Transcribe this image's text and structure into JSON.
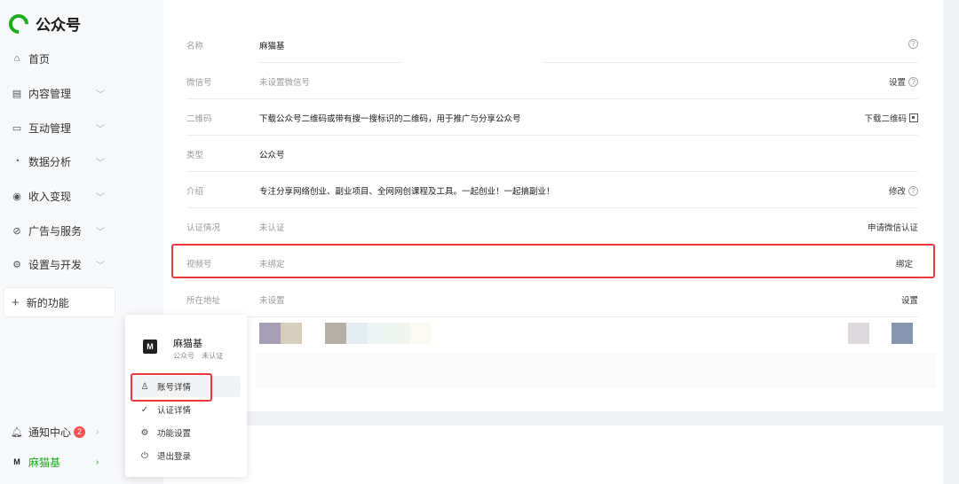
{
  "app": {
    "logo_text": "公众号"
  },
  "sidebar": {
    "items": [
      {
        "label": "首页",
        "icon": "home-icon",
        "glyph": "⌂",
        "chevron": false
      },
      {
        "label": "内容管理",
        "icon": "document-icon",
        "glyph": "▤",
        "chevron": true
      },
      {
        "label": "互动管理",
        "icon": "chat-icon",
        "glyph": "▭",
        "chevron": true
      },
      {
        "label": "数据分析",
        "icon": "chart-icon",
        "glyph": "◔",
        "chevron": true
      },
      {
        "label": "收入变现",
        "icon": "coin-icon",
        "glyph": "◉",
        "chevron": true
      },
      {
        "label": "广告与服务",
        "icon": "compass-icon",
        "glyph": "⊘",
        "chevron": true
      },
      {
        "label": "设置与开发",
        "icon": "gear-icon",
        "glyph": "⚙",
        "chevron": true
      }
    ],
    "new_feature": "新的功能",
    "notification": {
      "label": "通知中心",
      "count": "2"
    },
    "user": {
      "label": "麻猫基"
    }
  },
  "account": {
    "rows": [
      {
        "label": "名称",
        "value": "麻猫基",
        "action": ""
      },
      {
        "label": "微信号",
        "value": "未设置微信号",
        "action": "设置"
      },
      {
        "label": "二维码",
        "value": "下载公众号二维码或带有搜一搜标识的二维码，用于推广与分享公众号",
        "action": "下载二维码"
      },
      {
        "label": "类型",
        "value": "公众号",
        "action": ""
      },
      {
        "label": "介绍",
        "value": "专注分享网络创业、副业项目、全网网创课程及工具。一起创业！一起搞副业！",
        "action": "修改"
      },
      {
        "label": "认证情况",
        "value": "未认证",
        "action": "申请微信认证"
      },
      {
        "label": "视频号",
        "value": "未绑定",
        "action": "绑定"
      },
      {
        "label": "所在地址",
        "value": "未设置",
        "action": "设置"
      }
    ]
  },
  "popup": {
    "avatar_text": "M",
    "name": "麻猫基",
    "type": "公众号",
    "status": "未认证",
    "items": [
      {
        "label": "账号详情",
        "icon": "user-icon",
        "glyph": "♙"
      },
      {
        "label": "认证详情",
        "icon": "check-circle-icon",
        "glyph": "✓"
      },
      {
        "label": "功能设置",
        "icon": "gear-icon",
        "glyph": "⚙"
      },
      {
        "label": "退出登录",
        "icon": "power-icon",
        "glyph": "⏻"
      }
    ]
  },
  "colors": {
    "accent": "#1aad19",
    "highlight": "#e5393c",
    "badge": "#fa5151"
  },
  "swatches": [
    "#a59fb5",
    "#d6cfbd",
    "#b5b0a6",
    "#e4eef0",
    "#eef6f5",
    "#f1f5ef",
    "#fbfaf2",
    "#dcd8dc",
    "#8696ae"
  ]
}
